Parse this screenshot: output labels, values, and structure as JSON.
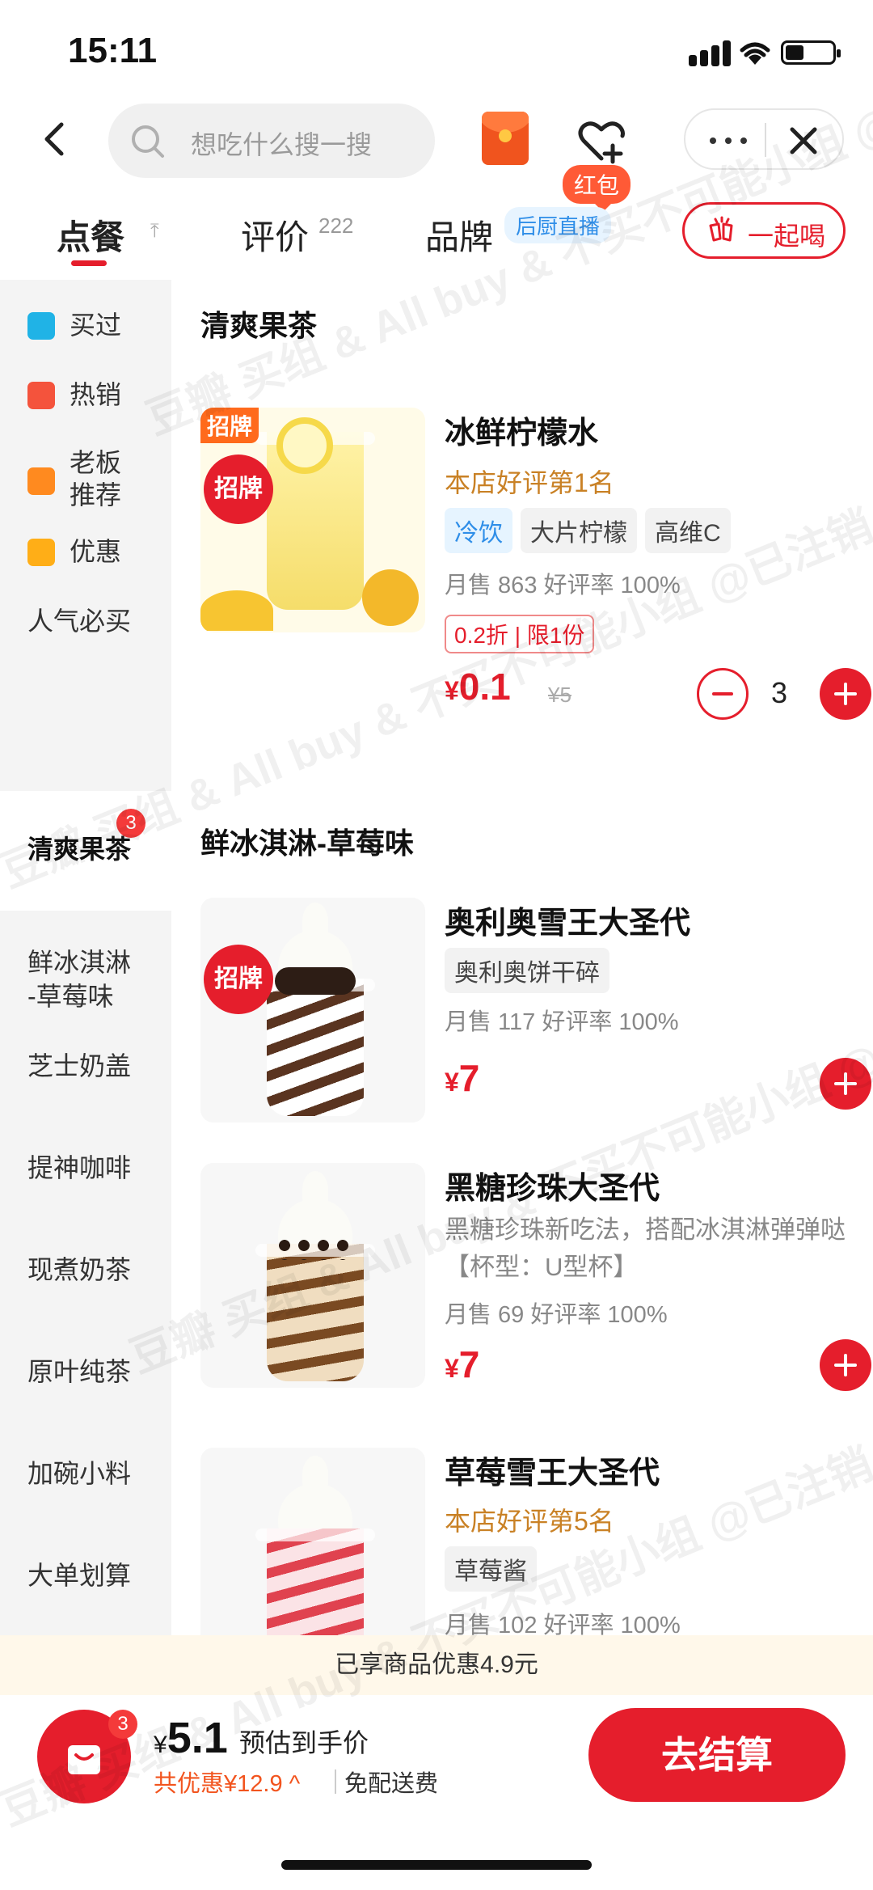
{
  "status_bar": {
    "time": "15:11"
  },
  "nav": {
    "search_placeholder": "想吃什么搜一搜",
    "red_packet_label": "红包"
  },
  "tabs": {
    "order": "点餐",
    "review": "评价",
    "review_count": "222",
    "brand": "品牌",
    "live_badge": "后厨直播",
    "together": "一起喝"
  },
  "sidebar": {
    "items": [
      {
        "label": "买过",
        "icon": "bought-icon",
        "color": "#20b3e6"
      },
      {
        "label": "热销",
        "icon": "fire-icon",
        "color": "#f4533c"
      },
      {
        "label": "老板推荐",
        "line1": "老板",
        "line2": "推荐",
        "icon": "thumb-up-icon",
        "color": "#ff8a1f"
      },
      {
        "label": "优惠",
        "icon": "discount-tag-icon",
        "color": "#ffae17"
      },
      {
        "label": "人气必买"
      },
      {
        "label": "清爽果茶",
        "badge": "3",
        "active": true
      },
      {
        "label": "鲜冰淇淋-草莓味",
        "line1": "鲜冰淇淋",
        "line2": "-草莓味"
      },
      {
        "label": "芝士奶盖"
      },
      {
        "label": "提神咖啡"
      },
      {
        "label": "现煮奶茶"
      },
      {
        "label": "原叶纯茶"
      },
      {
        "label": "加碗小料"
      },
      {
        "label": "大单划算"
      }
    ]
  },
  "sections": [
    {
      "title": "清爽果茶",
      "products": [
        {
          "name": "冰鲜柠檬水",
          "signature_badge": "招牌",
          "signature_stamp": "招牌",
          "rank": "本店好评第1名",
          "tags": [
            {
              "text": "冷饮",
              "style": "blue"
            },
            {
              "text": "大片柠檬"
            },
            {
              "text": "高维C"
            }
          ],
          "sales": "月售 863 好评率 100%",
          "promo": "0.2折 | 限1份",
          "currency": "¥",
          "price": "0.1",
          "original_price": "¥5",
          "quantity": "3"
        }
      ]
    },
    {
      "title": "鲜冰淇淋-草莓味",
      "products": [
        {
          "name": "奥利奥雪王大圣代",
          "signature_stamp": "招牌",
          "tags": [
            {
              "text": "奥利奥饼干碎"
            }
          ],
          "sales": "月售 117 好评率 100%",
          "currency": "¥",
          "price": "7"
        },
        {
          "name": "黑糖珍珠大圣代",
          "description": "黑糖珍珠新吃法，搭配冰淇淋弹弹哒【杯型：U型杯】",
          "sales": "月售 69 好评率 100%",
          "currency": "¥",
          "price": "7"
        },
        {
          "name": "草莓雪王大圣代",
          "rank": "本店好评第5名",
          "tags": [
            {
              "text": "草莓酱"
            }
          ],
          "sales": "月售 102 好评率 100%"
        }
      ]
    }
  ],
  "discount_banner": "已享商品优惠4.9元",
  "cart": {
    "badge": "3",
    "currency": "¥",
    "total": "5.1",
    "total_hint": "预估到手价",
    "saved": "共优惠¥12.9 ^",
    "free_delivery": "免配送费",
    "checkout": "去结算"
  },
  "watermark": "豆瓣 买组 & All buy & 不买不可能小组 @已注销",
  "colors": {
    "accent": "#e51e2c",
    "rank_gold": "#c98125",
    "orange": "#ff6a1c",
    "banner_bg": "#fff8ea"
  }
}
